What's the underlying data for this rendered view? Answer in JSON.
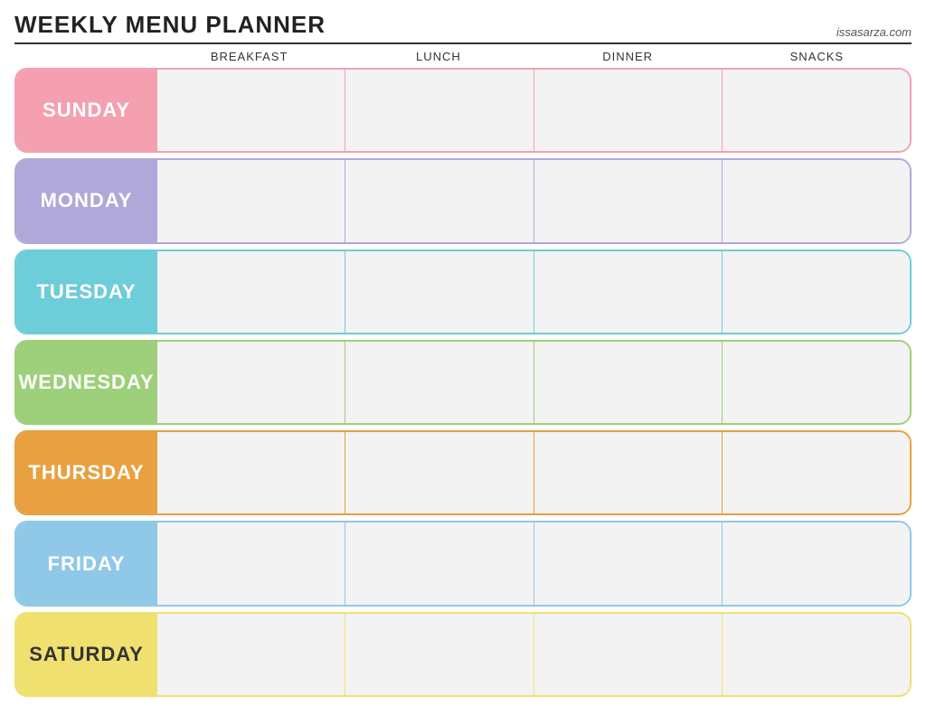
{
  "header": {
    "title": "Weekly Menu Planner",
    "website": "issasarza.com"
  },
  "columns": {
    "empty": "",
    "breakfast": "Breakfast",
    "lunch": "Lunch",
    "dinner": "Dinner",
    "snacks": "Snacks"
  },
  "days": [
    {
      "id": "sunday",
      "label": "Sunday",
      "color_class": "row-sunday"
    },
    {
      "id": "monday",
      "label": "Monday",
      "color_class": "row-monday"
    },
    {
      "id": "tuesday",
      "label": "Tuesday",
      "color_class": "row-tuesday"
    },
    {
      "id": "wednesday",
      "label": "Wednesday",
      "color_class": "row-wednesday"
    },
    {
      "id": "thursday",
      "label": "Thursday",
      "color_class": "row-thursday"
    },
    {
      "id": "friday",
      "label": "Friday",
      "color_class": "row-friday"
    },
    {
      "id": "saturday",
      "label": "Saturday",
      "color_class": "row-saturday"
    }
  ]
}
